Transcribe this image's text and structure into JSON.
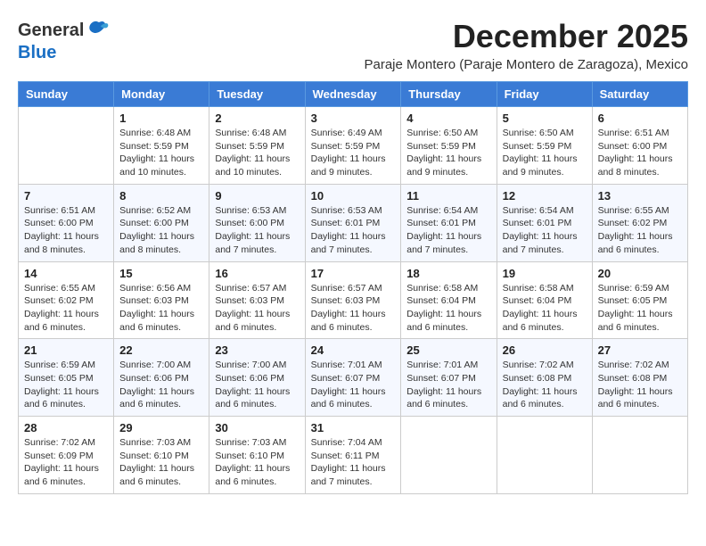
{
  "header": {
    "logo": {
      "line1": "General",
      "line2": "Blue"
    },
    "month": "December 2025",
    "location": "Paraje Montero (Paraje Montero de Zaragoza), Mexico"
  },
  "weekdays": [
    "Sunday",
    "Monday",
    "Tuesday",
    "Wednesday",
    "Thursday",
    "Friday",
    "Saturday"
  ],
  "weeks": [
    [
      {
        "day": "",
        "info": ""
      },
      {
        "day": "1",
        "info": "Sunrise: 6:48 AM\nSunset: 5:59 PM\nDaylight: 11 hours\nand 10 minutes."
      },
      {
        "day": "2",
        "info": "Sunrise: 6:48 AM\nSunset: 5:59 PM\nDaylight: 11 hours\nand 10 minutes."
      },
      {
        "day": "3",
        "info": "Sunrise: 6:49 AM\nSunset: 5:59 PM\nDaylight: 11 hours\nand 9 minutes."
      },
      {
        "day": "4",
        "info": "Sunrise: 6:50 AM\nSunset: 5:59 PM\nDaylight: 11 hours\nand 9 minutes."
      },
      {
        "day": "5",
        "info": "Sunrise: 6:50 AM\nSunset: 5:59 PM\nDaylight: 11 hours\nand 9 minutes."
      },
      {
        "day": "6",
        "info": "Sunrise: 6:51 AM\nSunset: 6:00 PM\nDaylight: 11 hours\nand 8 minutes."
      }
    ],
    [
      {
        "day": "7",
        "info": "Sunrise: 6:51 AM\nSunset: 6:00 PM\nDaylight: 11 hours\nand 8 minutes."
      },
      {
        "day": "8",
        "info": "Sunrise: 6:52 AM\nSunset: 6:00 PM\nDaylight: 11 hours\nand 8 minutes."
      },
      {
        "day": "9",
        "info": "Sunrise: 6:53 AM\nSunset: 6:00 PM\nDaylight: 11 hours\nand 7 minutes."
      },
      {
        "day": "10",
        "info": "Sunrise: 6:53 AM\nSunset: 6:01 PM\nDaylight: 11 hours\nand 7 minutes."
      },
      {
        "day": "11",
        "info": "Sunrise: 6:54 AM\nSunset: 6:01 PM\nDaylight: 11 hours\nand 7 minutes."
      },
      {
        "day": "12",
        "info": "Sunrise: 6:54 AM\nSunset: 6:01 PM\nDaylight: 11 hours\nand 7 minutes."
      },
      {
        "day": "13",
        "info": "Sunrise: 6:55 AM\nSunset: 6:02 PM\nDaylight: 11 hours\nand 6 minutes."
      }
    ],
    [
      {
        "day": "14",
        "info": "Sunrise: 6:55 AM\nSunset: 6:02 PM\nDaylight: 11 hours\nand 6 minutes."
      },
      {
        "day": "15",
        "info": "Sunrise: 6:56 AM\nSunset: 6:03 PM\nDaylight: 11 hours\nand 6 minutes."
      },
      {
        "day": "16",
        "info": "Sunrise: 6:57 AM\nSunset: 6:03 PM\nDaylight: 11 hours\nand 6 minutes."
      },
      {
        "day": "17",
        "info": "Sunrise: 6:57 AM\nSunset: 6:03 PM\nDaylight: 11 hours\nand 6 minutes."
      },
      {
        "day": "18",
        "info": "Sunrise: 6:58 AM\nSunset: 6:04 PM\nDaylight: 11 hours\nand 6 minutes."
      },
      {
        "day": "19",
        "info": "Sunrise: 6:58 AM\nSunset: 6:04 PM\nDaylight: 11 hours\nand 6 minutes."
      },
      {
        "day": "20",
        "info": "Sunrise: 6:59 AM\nSunset: 6:05 PM\nDaylight: 11 hours\nand 6 minutes."
      }
    ],
    [
      {
        "day": "21",
        "info": "Sunrise: 6:59 AM\nSunset: 6:05 PM\nDaylight: 11 hours\nand 6 minutes."
      },
      {
        "day": "22",
        "info": "Sunrise: 7:00 AM\nSunset: 6:06 PM\nDaylight: 11 hours\nand 6 minutes."
      },
      {
        "day": "23",
        "info": "Sunrise: 7:00 AM\nSunset: 6:06 PM\nDaylight: 11 hours\nand 6 minutes."
      },
      {
        "day": "24",
        "info": "Sunrise: 7:01 AM\nSunset: 6:07 PM\nDaylight: 11 hours\nand 6 minutes."
      },
      {
        "day": "25",
        "info": "Sunrise: 7:01 AM\nSunset: 6:07 PM\nDaylight: 11 hours\nand 6 minutes."
      },
      {
        "day": "26",
        "info": "Sunrise: 7:02 AM\nSunset: 6:08 PM\nDaylight: 11 hours\nand 6 minutes."
      },
      {
        "day": "27",
        "info": "Sunrise: 7:02 AM\nSunset: 6:08 PM\nDaylight: 11 hours\nand 6 minutes."
      }
    ],
    [
      {
        "day": "28",
        "info": "Sunrise: 7:02 AM\nSunset: 6:09 PM\nDaylight: 11 hours\nand 6 minutes."
      },
      {
        "day": "29",
        "info": "Sunrise: 7:03 AM\nSunset: 6:10 PM\nDaylight: 11 hours\nand 6 minutes."
      },
      {
        "day": "30",
        "info": "Sunrise: 7:03 AM\nSunset: 6:10 PM\nDaylight: 11 hours\nand 6 minutes."
      },
      {
        "day": "31",
        "info": "Sunrise: 7:04 AM\nSunset: 6:11 PM\nDaylight: 11 hours\nand 7 minutes."
      },
      {
        "day": "",
        "info": ""
      },
      {
        "day": "",
        "info": ""
      },
      {
        "day": "",
        "info": ""
      }
    ]
  ]
}
